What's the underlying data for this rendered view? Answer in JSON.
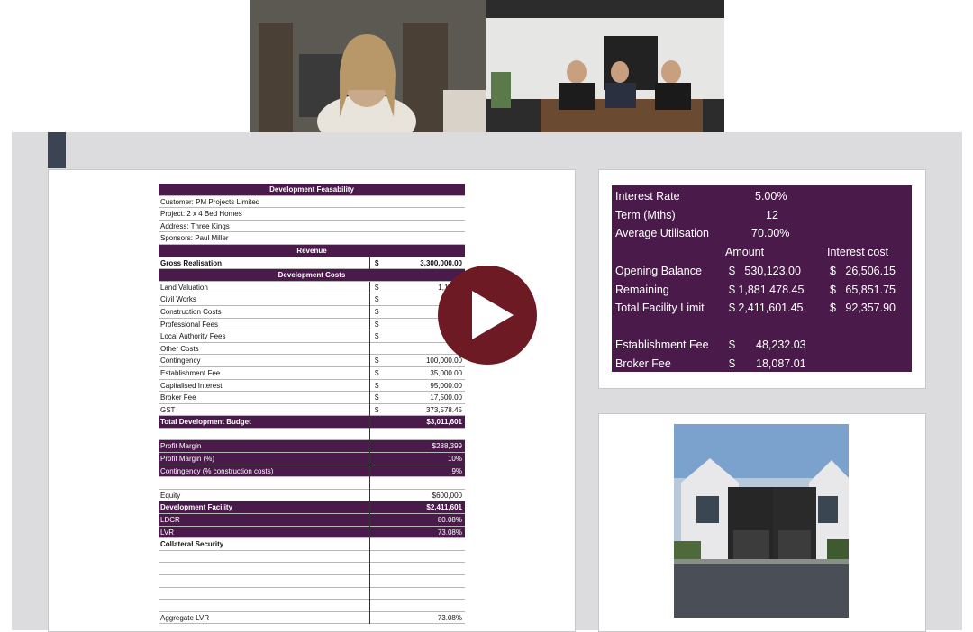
{
  "spreadsheet": {
    "title": "Development Feasability",
    "info": [
      "Customer: PM Projects Limited",
      "Project: 2 x 4 Bed Homes",
      "Address: Three Kings",
      "Sponsors:  Paul Miller"
    ],
    "revenue_header": "Revenue",
    "gross_realisation": {
      "label": "Gross Realisation",
      "cur": "$",
      "value": "3,300,000.00"
    },
    "costs_header": "Development Costs",
    "costs": [
      {
        "label": "Land Valuation",
        "cur": "$",
        "value": "1,130,1"
      },
      {
        "label": "Civil Works",
        "cur": "$",
        "value": ""
      },
      {
        "label": "Construction Costs",
        "cur": "$",
        "value": "1,118"
      },
      {
        "label": "Professional Fees",
        "cur": "$",
        "value": "75"
      },
      {
        "label": "Local Authority Fees",
        "cur": "$",
        "value": "67,4"
      },
      {
        "label": "Other Costs",
        "cur": "",
        "value": ""
      },
      {
        "label": "Contingency",
        "cur": "$",
        "value": "100,000.00"
      },
      {
        "label": "Establishment Fee",
        "cur": "$",
        "value": "35,000.00"
      },
      {
        "label": "Capitalised Interest",
        "cur": "$",
        "value": "95,000.00"
      },
      {
        "label": "Broker Fee",
        "cur": "$",
        "value": "17,500.00"
      },
      {
        "label": "GST",
        "cur": "$",
        "value": "373,578.45"
      }
    ],
    "total_budget": {
      "label": "Total Development Budget",
      "value": "$3,011,601"
    },
    "profit": [
      {
        "label": "Profit Margin",
        "value": "$288,399"
      },
      {
        "label": "Profit Margin (%)",
        "value": "10%"
      },
      {
        "label": "Contingency (% construction costs)",
        "value": "9%"
      }
    ],
    "equity": {
      "label": "Equity",
      "value": "$600,000"
    },
    "facility": [
      {
        "label": "Development Facility",
        "value": "$2,411,601"
      },
      {
        "label": "LDCR",
        "value": "80.08%"
      },
      {
        "label": "LVR",
        "value": "73.08%"
      }
    ],
    "collateral_label": "Collateral Security",
    "aggregate": {
      "label": "Aggregate LVR",
      "value": "73.08%"
    }
  },
  "interest": {
    "rate_label": "Interest Rate",
    "rate_value": "5.00%",
    "term_label": "Term (Mths)",
    "term_value": "12",
    "util_label": "Average Utilisation",
    "util_value": "70.00%",
    "amount_header": "Amount",
    "cost_header": "Interest cost",
    "rows": [
      {
        "label": "Opening Balance",
        "amount": "$   530,123.00",
        "cost": "$   26,506.15"
      },
      {
        "label": "Remaining",
        "amount": "$ 1,881,478.45",
        "cost": "$   65,851.75"
      },
      {
        "label": "Total Facility Limit",
        "amount": "$ 2,411,601.45",
        "cost": "$   92,357.90"
      }
    ],
    "est_label": "Establishment Fee",
    "est_cur": "$",
    "est_value": "48,232.03",
    "broker_label": "Broker Fee",
    "broker_cur": "$",
    "broker_value": "18,087.01"
  },
  "colors": {
    "table_purple": "#4a1a4a",
    "play_button": "#6e1a24"
  }
}
